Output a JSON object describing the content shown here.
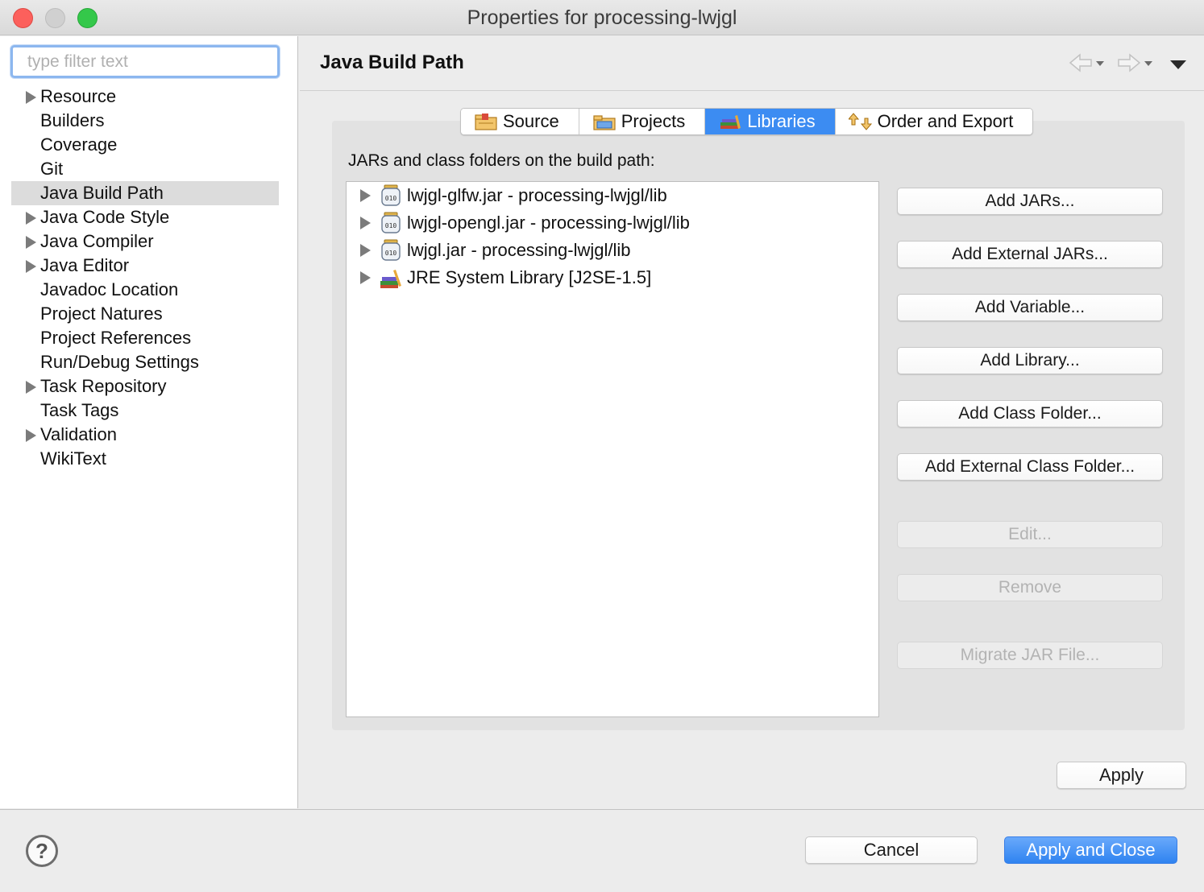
{
  "window": {
    "title": "Properties for processing-lwjgl",
    "close_color": "#fc605c",
    "maximize_color": "#34c84a"
  },
  "filter": {
    "placeholder": "type filter text",
    "value": ""
  },
  "tree": {
    "items": [
      {
        "label": "Resource",
        "expandable": true,
        "selected": false
      },
      {
        "label": "Builders",
        "expandable": false,
        "selected": false
      },
      {
        "label": "Coverage",
        "expandable": false,
        "selected": false
      },
      {
        "label": "Git",
        "expandable": false,
        "selected": false
      },
      {
        "label": "Java Build Path",
        "expandable": false,
        "selected": true
      },
      {
        "label": "Java Code Style",
        "expandable": true,
        "selected": false
      },
      {
        "label": "Java Compiler",
        "expandable": true,
        "selected": false
      },
      {
        "label": "Java Editor",
        "expandable": true,
        "selected": false
      },
      {
        "label": "Javadoc Location",
        "expandable": false,
        "selected": false
      },
      {
        "label": "Project Natures",
        "expandable": false,
        "selected": false
      },
      {
        "label": "Project References",
        "expandable": false,
        "selected": false
      },
      {
        "label": "Run/Debug Settings",
        "expandable": false,
        "selected": false
      },
      {
        "label": "Task Repository",
        "expandable": true,
        "selected": false
      },
      {
        "label": "Task Tags",
        "expandable": false,
        "selected": false
      },
      {
        "label": "Validation",
        "expandable": true,
        "selected": false
      },
      {
        "label": "WikiText",
        "expandable": false,
        "selected": false
      }
    ]
  },
  "header": {
    "title": "Java Build Path"
  },
  "tabs": [
    {
      "label": "Source",
      "icon": "source-folder-icon",
      "active": false
    },
    {
      "label": "Projects",
      "icon": "projects-folder-icon",
      "active": false
    },
    {
      "label": "Libraries",
      "icon": "libraries-icon",
      "active": true
    },
    {
      "label": "Order and Export",
      "icon": "order-export-icon",
      "active": false
    }
  ],
  "libraries": {
    "list_label": "JARs and class folders on the build path:",
    "entries": [
      {
        "label": "lwjgl-glfw.jar - processing-lwjgl/lib",
        "icon": "jar-icon"
      },
      {
        "label": "lwjgl-opengl.jar - processing-lwjgl/lib",
        "icon": "jar-icon"
      },
      {
        "label": "lwjgl.jar - processing-lwjgl/lib",
        "icon": "jar-icon"
      },
      {
        "label": "JRE System Library [J2SE-1.5]",
        "icon": "jre-library-icon"
      }
    ],
    "buttons": {
      "add_jars": "Add JARs...",
      "add_external_jars": "Add External JARs...",
      "add_variable": "Add Variable...",
      "add_library": "Add Library...",
      "add_class_folder": "Add Class Folder...",
      "add_external_class_folder": "Add External Class Folder...",
      "edit": "Edit...",
      "remove": "Remove",
      "migrate_jar": "Migrate JAR File..."
    }
  },
  "footer": {
    "apply": "Apply",
    "help_glyph": "?",
    "cancel": "Cancel",
    "apply_and_close": "Apply and Close",
    "accent_color": "#3c8cf2"
  }
}
